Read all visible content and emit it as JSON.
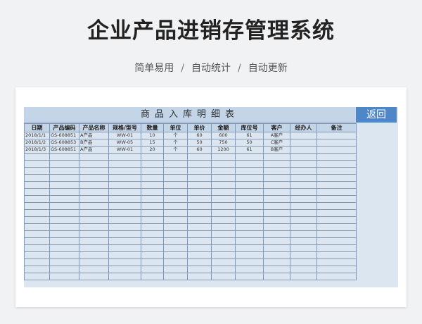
{
  "header": {
    "title": "企业产品进销存管理系统",
    "features": [
      "简单易用",
      "自动统计",
      "自动更新"
    ],
    "separator": "/"
  },
  "sheet": {
    "title": "商品入库明细表",
    "return_label": "返回",
    "columns": [
      "日期",
      "产品编码",
      "产品名称",
      "规格/型号",
      "数量",
      "单位",
      "单价",
      "金额",
      "库位号",
      "客户",
      "经办人",
      "备注"
    ],
    "rows": [
      [
        "2018/1/1",
        "GS-608851",
        "A产品",
        "WW-01",
        "10",
        "个",
        "60",
        "600",
        "61",
        "A客户",
        "",
        ""
      ],
      [
        "2018/1/2",
        "GS-608853",
        "B产品",
        "WW-05",
        "15",
        "个",
        "50",
        "750",
        "50",
        "C客户",
        "",
        ""
      ],
      [
        "2018/1/3",
        "GS-608851",
        "A产品",
        "WW-01",
        "20",
        "个",
        "60",
        "1200",
        "61",
        "B客户",
        "",
        ""
      ]
    ],
    "empty_row_count": 18
  },
  "colors": {
    "sheet_bg": "#dce6f1",
    "header_bg": "#c5d5e8",
    "button_bg": "#4f86c6"
  }
}
